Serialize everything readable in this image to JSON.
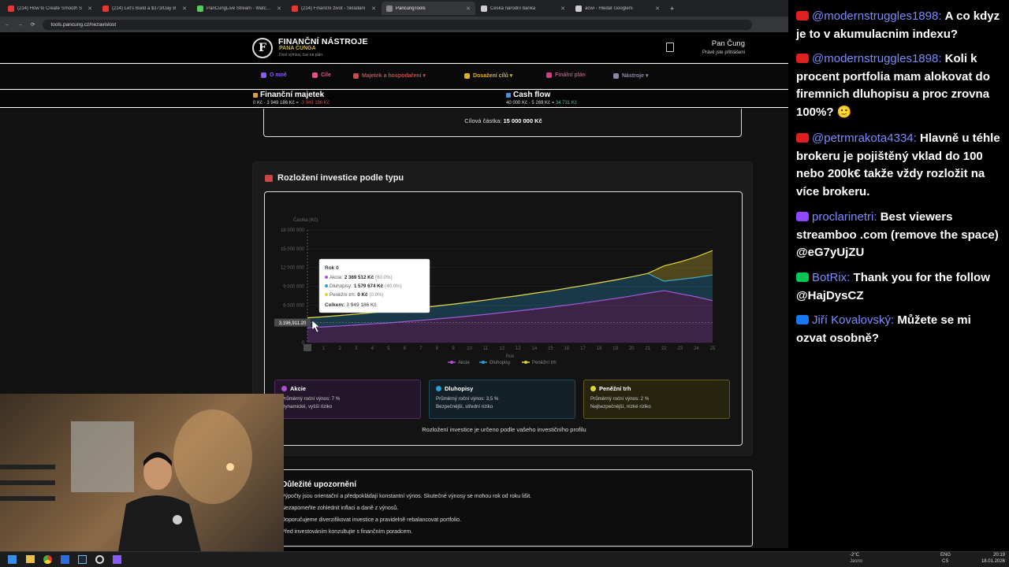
{
  "browser": {
    "tabs": [
      {
        "title": "(214) How to Create Smooth S",
        "color": "#e33"
      },
      {
        "title": "(214) Let's Build a $373/Day B",
        "color": "#e33"
      },
      {
        "title": "PanCungLive Stream - Watch Li",
        "color": "#5c5"
      },
      {
        "title": "(214) Finanční život - Skládání",
        "color": "#e33"
      },
      {
        "title": "PancungTools",
        "color": "#888"
      },
      {
        "title": "Česká národní banka",
        "color": "#ccc"
      },
      {
        "title": "acwi - Hledat Googlem",
        "color": "#ccc"
      }
    ],
    "url": "tools.pancung.cz/nezavislost"
  },
  "header": {
    "logo_letter": "F",
    "title": "FINANČNÍ NÁSTROJE",
    "subtitle": "PANA ČUNGA",
    "tagline": "Dost výmluv, čas na plán.",
    "user_name": "Pan Čung",
    "user_status": "Právě jste přihlášeni"
  },
  "nav": {
    "items": [
      {
        "label": "O mně",
        "color": "#8a5cf6"
      },
      {
        "label": "Cíle",
        "color": "#e05580"
      },
      {
        "label": "Majetek a hospodaření ▾",
        "color": "#c0504d"
      },
      {
        "label": "Dosažení cílů ▾",
        "color": "#e0b020"
      },
      {
        "label": "Finální plán",
        "color": "#d04080"
      },
      {
        "label": "Nástroje ▾",
        "color": "#8888aa"
      }
    ]
  },
  "summary": {
    "assets_title": "Finanční majetek",
    "assets_a": "0 Kč",
    "assets_b": "3 949 186 Kč",
    "assets_c": "-3 949 186 Kč",
    "cash_title": "Cash flow",
    "cash_a": "40 000 Kč",
    "cash_b": "5 269 Kč",
    "cash_c": "34 731 Kč"
  },
  "goal": {
    "label": "Cílová částka:",
    "value": "15 000 000 Kč"
  },
  "section": {
    "title": "Rozložení investice podle typu"
  },
  "chart_data": {
    "type": "area",
    "ylabel": "Částka (Kč)",
    "xlabel": "Rok",
    "ylim": [
      0,
      18000000
    ],
    "yticks": [
      "18 000 000",
      "15 000 000",
      "12 000 000",
      "9 000 000",
      "6 000 000",
      "3 000 000",
      "0"
    ],
    "ytick_values": [
      18000000,
      15000000,
      12000000,
      9000000,
      6000000,
      3000000,
      0
    ],
    "x": [
      0,
      1,
      2,
      3,
      4,
      5,
      6,
      7,
      8,
      9,
      10,
      11,
      12,
      13,
      14,
      15,
      16,
      17,
      18,
      19,
      20,
      21,
      22,
      23,
      24,
      25
    ],
    "stacked": true,
    "series": [
      {
        "name": "Akcie",
        "color": "#b04fd6",
        "values": [
          2369512,
          2500000,
          2650000,
          2800000,
          2980000,
          3150000,
          3350000,
          3550000,
          3780000,
          4000000,
          4250000,
          4500000,
          4780000,
          5050000,
          5350000,
          5650000,
          5980000,
          6320000,
          6680000,
          7050000,
          7450000,
          7900000,
          8300000,
          7800000,
          7300000,
          6700000
        ]
      },
      {
        "name": "Dluhopisy",
        "color": "#2a9fd6",
        "values": [
          1579674,
          1620000,
          1680000,
          1740000,
          1800000,
          1870000,
          1930000,
          2000000,
          2070000,
          2140000,
          2220000,
          2290000,
          2370000,
          2440000,
          2530000,
          2600000,
          2700000,
          2780000,
          2870000,
          2960000,
          3050000,
          3150000,
          1500000,
          2300000,
          3100000,
          4100000
        ]
      },
      {
        "name": "Peněžní trh",
        "color": "#e6d233",
        "values": [
          0,
          0,
          0,
          0,
          0,
          0,
          0,
          0,
          0,
          0,
          0,
          0,
          0,
          0,
          0,
          0,
          0,
          0,
          0,
          0,
          0,
          0,
          2450000,
          2800000,
          3300000,
          3900000
        ]
      }
    ],
    "crosshair_label": "3,196,911.20",
    "tooltip": {
      "title": "Rok 0",
      "rows": [
        {
          "name": "Akcie:",
          "value": "2 369 512 Kč",
          "pct": "(60.0%)",
          "color": "#b04fd6"
        },
        {
          "name": "Dluhopisy:",
          "value": "1 579 674 Kč",
          "pct": "(40.0%)",
          "color": "#2a9fd6"
        },
        {
          "name": "Peněžní trh:",
          "value": "0 Kč",
          "pct": "(0.0%)",
          "color": "#e6d233"
        }
      ],
      "total_label": "Celkem:",
      "total_value": "3 949 186 Kč"
    }
  },
  "cards": [
    {
      "title": "Akcie",
      "line1": "Průměrný roční výnos: 7 %",
      "line2": "Dynamické, vyšší riziko",
      "color": "#b04fd6",
      "bg": "#24162b"
    },
    {
      "title": "Dluhopisy",
      "line1": "Průměrný roční výnos: 3,5 %",
      "line2": "Bezpečnější, střední riziko",
      "color": "#2a9fd6",
      "bg": "#142028"
    },
    {
      "title": "Peněžní trh",
      "line1": "Průměrný roční výnos: 2 %",
      "line2": "Nejbezpečnější, nízké riziko",
      "color": "#e6d233",
      "bg": "#26230f"
    }
  ],
  "profile_note": "Rozložení investice je určeno podle vašeho investičního profilu",
  "warning": {
    "title": "Důležité upozornění",
    "items": [
      "Výpočty jsou orientační a předpokládají konstantní výnos. Skutečné výnosy se mohou rok od roku lišit.",
      "Nezapomeňte zohlednit inflaci a daně z výnosů.",
      "Doporučujeme diverzifikovat investice a pravidelně rebalancovat portfolio.",
      "Před investováním konzultujte s finančním poradcem."
    ]
  },
  "chat": [
    {
      "user": "@modernstruggles1898",
      "text": "A co kdyz je to v akumulacnim indexu?",
      "user_color": "#7b8cff",
      "badge": "#e02020"
    },
    {
      "user": "@modernstruggles1898",
      "text": "Koli k procent portfolia mam alokovat do firemnich dluhopisu a proc zrovna 100%? 🙂",
      "user_color": "#7b8cff",
      "badge": "#e02020"
    },
    {
      "user": "@petrmrakota4334",
      "text": "Hlavně u téhle brokeru je pojištěný vklad do 100 nebo 200k€ takže vždy rozložit na více brokeru.",
      "user_color": "#7b8cff",
      "badge": "#e02020"
    },
    {
      "user": "proclarinetri",
      "text": "Best viewers streamboo .com (remove the space) @eG7yUjZU",
      "user_color": "#7b8cff",
      "badge": "#9146ff"
    },
    {
      "user": "BotRix",
      "text": "Thank you for the follow @HajDysCZ",
      "user_color": "#7b8cff",
      "badge": "#00c853"
    },
    {
      "user": "Jiří Kovalovský",
      "text": "Můžete se mi ozvat osobně?",
      "user_color": "#7b8cff",
      "badge": "#1877f2"
    }
  ],
  "taskbar": {
    "weather_temp": "-2°C",
    "weather_desc": "Jasno",
    "lang1": "ENG",
    "lang2": "CS",
    "time": "20:19",
    "date": "18.01.2026"
  }
}
